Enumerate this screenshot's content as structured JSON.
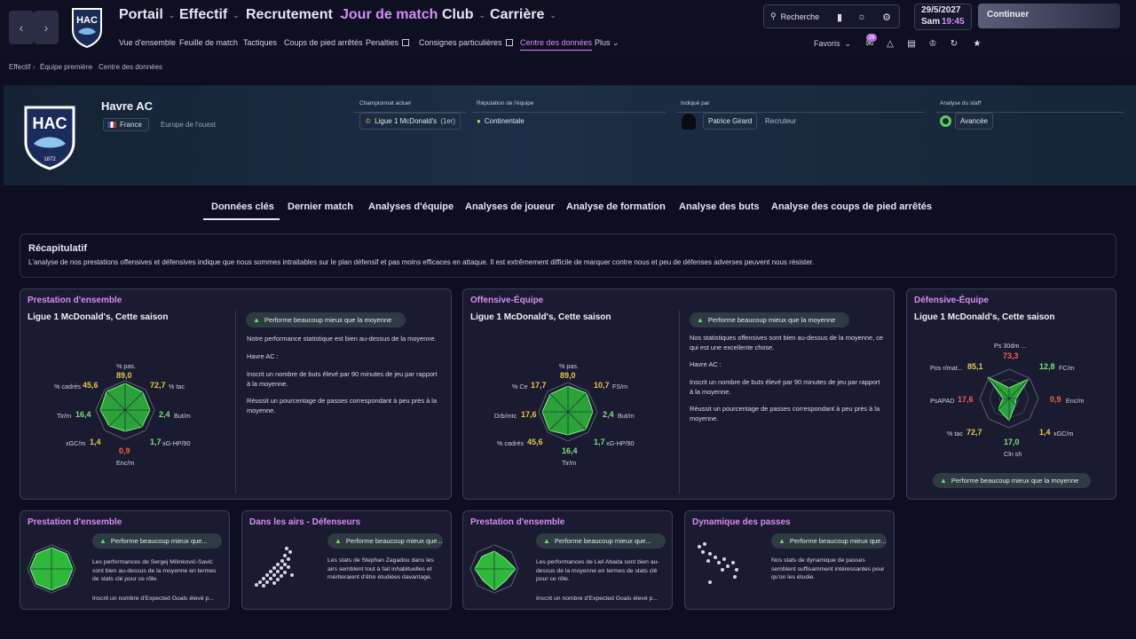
{
  "topbar": {
    "menu": [
      "Portail",
      "Effectif",
      "Recrutement",
      "Jour de match",
      "Club",
      "Carrière"
    ],
    "submenu": [
      "Vue d'ensemble",
      "Feuille de match",
      "Tactiques",
      "Coups de pied arrêtés",
      "Penalties",
      "Consignes particulières",
      "Centre des données",
      "Plus"
    ],
    "search_label": "Recherche",
    "date": "29/5/2027",
    "day": "Sam",
    "time": "19:45",
    "continue_label": "Continuer",
    "favorites_label": "Favoris",
    "badge_count": "29"
  },
  "breadcrumb": [
    "Effectif",
    "Équipe première",
    "Centre des données"
  ],
  "team": {
    "name": "Havre AC",
    "crest_text": "HAC",
    "crest_year": "1872",
    "country": "France",
    "region": "Europe de l'ouest",
    "championship_label": "Championnat actuel",
    "championship": "Ligue 1 McDonald's",
    "championship_rank": "(1er)",
    "reputation_label": "Réputation de l'équipe",
    "reputation": "Continentale",
    "indicated_label": "Indiqué par",
    "indicated_name": "Patrice Girard",
    "indicated_role": "Recruteur",
    "staff_label": "Analyse du staff",
    "staff_value": "Avancée"
  },
  "tabs": [
    "Données clés",
    "Dernier match",
    "Analyses d'équipe",
    "Analyses de joueur",
    "Analyse de formation",
    "Analyse des buts",
    "Analyse des coups de pied arrêtés"
  ],
  "summary": {
    "title": "Récapitulatif",
    "text": "L'analyse de nos prestations offensives et défensives indique que nous sommes intraitables sur le plan défensif et pas moins efficaces en attaque. Il est extrêmement difficile de marquer contre nous et peu de défenses adverses peuvent nous résister."
  },
  "cards": {
    "overall": {
      "title": "Prestation d'ensemble",
      "subtitle": "Ligue 1 McDonald's, Cette saison",
      "pill": "Performe beaucoup mieux que la moyenne",
      "p1": "Notre performance statistique est bien au-dessus de la moyenne.",
      "p2": "Havre AC :",
      "p3": "Inscrit un nombre de buts élevé par 90 minutes de jeu par rapport à la moyenne.",
      "p4": "Réussit un pourcentage de passes correspondant à peu près à la moyenne.",
      "radar": {
        "pct_pas_label": "% pas.",
        "pct_pas": "89,0",
        "pct_tac_label": "% tac",
        "pct_tac": "72,7",
        "but_label": "But/m",
        "but": "2,4",
        "xg_label": "xG-HP/90",
        "xg": "1,7",
        "enc_label": "Enc/m",
        "enc": "0,9",
        "xgc_label": "xGC/m",
        "xgc": "1,4",
        "tir_label": "Tir/m",
        "tir": "16,4",
        "cad_label": "% cadrés",
        "cad": "45,6"
      }
    },
    "offense": {
      "title": "Offensive-Équipe",
      "subtitle": "Ligue 1 McDonald's, Cette saison",
      "pill": "Performe beaucoup mieux que la moyenne",
      "p1": "Nos statistiques offensives sont bien au-dessus de la moyenne, ce qui est une excellente chose.",
      "p2": "Havre AC :",
      "p3": "Inscrit un nombre de buts élevé par 90 minutes de jeu par rapport à la moyenne.",
      "p4": "Réussit un pourcentage de passes correspondant à peu près à la moyenne.",
      "radar": {
        "pct_pas_label": "% pas.",
        "pct_pas": "89,0",
        "fs_label": "FS/m",
        "fs": "10,7",
        "but_label": "But/m",
        "but": "2,4",
        "xg_label": "xG-HP/90",
        "xg": "1,7",
        "tir_label": "Tir/m",
        "tir": "16,4",
        "cad_label": "% cadrés",
        "cad": "45,6",
        "drb_label": "Drb/mtc",
        "drb": "17,6",
        "ce_label": "% Ce",
        "ce": "17,7"
      }
    },
    "defense": {
      "title": "Défensive-Équipe",
      "subtitle": "Ligue 1 McDonald's, Cette saison",
      "pill": "Performe beaucoup mieux que la moyenne",
      "radar": {
        "ps30_label": "Ps 30dm ...",
        "ps30": "73,3",
        "fc_label": "FC/m",
        "fc": "12,8",
        "enc_label": "Enc/m",
        "enc": "0,9",
        "xgc_label": "xGC/m",
        "xgc": "1,4",
        "cln_label": "Cln sh",
        "cln": "17,0",
        "tac_label": "% tac",
        "tac": "72,7",
        "psapad_label": "PsAPAD",
        "psapad": "17,6",
        "pos_label": "Pos r/mat...",
        "pos": "85,1"
      }
    },
    "mini1": {
      "title": "Prestation d'ensemble",
      "pill": "Performe beaucoup mieux que...",
      "text": "Les performances de Sergej Milinković-Savić sont bien au-dessus de la moyenne en termes de stats clé pour ce rôle.",
      "text2": "Inscrit un nombre d'Expected Goals élevé p..."
    },
    "mini2": {
      "title": "Dans les airs - Défenseurs",
      "pill": "Performe beaucoup mieux que...",
      "text": "Les stats de Stephan Zagadou dans les airs semblent tout à fait inhabituelles et mériteraient d'être étudiées davantage."
    },
    "mini3": {
      "title": "Prestation d'ensemble",
      "pill": "Performe beaucoup mieux que...",
      "text": "Les performances de Liel Abada sont bien au-dessus de la moyenne en termes de stats clé pour ce rôle.",
      "text2": "Inscrit un nombre d'Expected Goals élevé p..."
    },
    "mini4": {
      "title": "Dynamique des passes",
      "pill": "Performe beaucoup mieux que...",
      "text": "Nos stats de dynamique de passes semblent suffisamment intéressantes pour qu'on les étudie."
    }
  },
  "colors": {
    "accent": "#d88bf5",
    "good": "#7fe07a",
    "mid": "#e6c64a",
    "bad": "#f2624e",
    "radar_fill": "#3ec04a"
  }
}
